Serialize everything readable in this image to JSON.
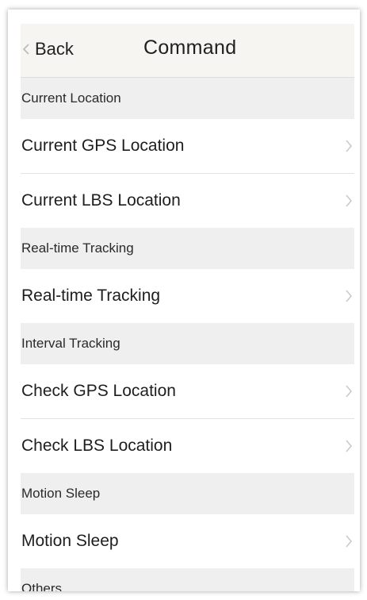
{
  "header": {
    "back_label": "Back",
    "title": "Command"
  },
  "sections": [
    {
      "label": "Current Location",
      "items": [
        "Current GPS Location",
        "Current LBS Location"
      ]
    },
    {
      "label": "Real-time Tracking",
      "items": [
        "Real-time Tracking"
      ]
    },
    {
      "label": "Interval Tracking",
      "items": [
        "Check GPS Location",
        "Check LBS Location"
      ]
    },
    {
      "label": "Motion Sleep",
      "items": [
        "Motion Sleep"
      ]
    },
    {
      "label": "Others",
      "items": []
    }
  ],
  "colors": {
    "header_bg": "#f6f5f2",
    "section_bg": "#efefef",
    "row_bg": "#ffffff",
    "divider": "#e2e2e2",
    "chevron": "#c8c8c8"
  }
}
